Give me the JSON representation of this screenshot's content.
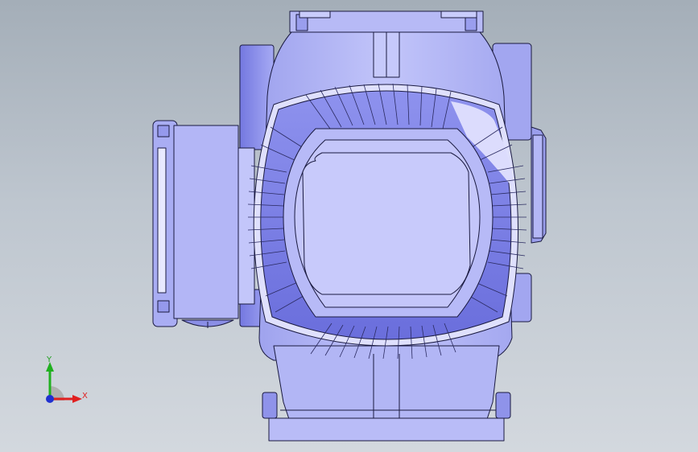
{
  "viewport": {
    "background_top": "#a4aeb8",
    "background_bottom": "#d3d8de",
    "part_color": "#b5b8f4",
    "edge_color": "#1a1a40"
  },
  "triad": {
    "x_label": "X",
    "y_label": "Y",
    "x_color": "#e02020",
    "y_color": "#20b020",
    "z_color": "#2030d0"
  }
}
